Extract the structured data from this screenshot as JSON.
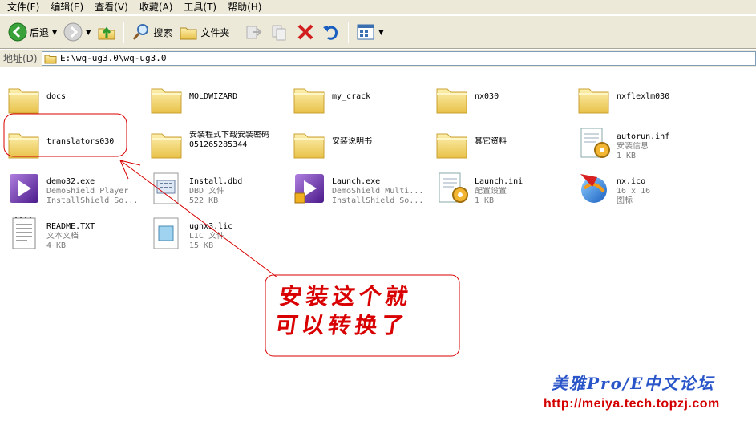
{
  "menu": [
    "文件(F)",
    "编辑(E)",
    "查看(V)",
    "收藏(A)",
    "工具(T)",
    "帮助(H)"
  ],
  "toolbar": {
    "back_label": "后退",
    "search_label": "搜索",
    "folders_label": "文件夹"
  },
  "address": {
    "label": "地址(D)",
    "path": "E:\\wq-ug3.0\\wq-ug3.0"
  },
  "files": [
    {
      "name": "docs",
      "type": "folder"
    },
    {
      "name": "MOLDWIZARD",
      "type": "folder"
    },
    {
      "name": "my_crack",
      "type": "folder"
    },
    {
      "name": "nx030",
      "type": "folder"
    },
    {
      "name": "nxflexlm030",
      "type": "folder"
    },
    {
      "name": "translators030",
      "type": "folder"
    },
    {
      "name": "安装程式下载安装密码051265285344",
      "type": "folder"
    },
    {
      "name": "安装说明书",
      "type": "folder"
    },
    {
      "name": "其它资料",
      "type": "folder"
    },
    {
      "name": "autorun.inf",
      "type": "inf",
      "line2": "安装信息",
      "line3": "1 KB"
    },
    {
      "name": "demo32.exe",
      "type": "exe",
      "line2": "DemoShield Player",
      "line3": "InstallShield So..."
    },
    {
      "name": "Install.dbd",
      "type": "dbd",
      "line2": "DBD 文件",
      "line3": "522 KB"
    },
    {
      "name": "Launch.exe",
      "type": "exe2",
      "line2": "DemoShield Multi...",
      "line3": "InstallShield So..."
    },
    {
      "name": "Launch.ini",
      "type": "ini",
      "line2": "配置设置",
      "line3": "1 KB"
    },
    {
      "name": "nx.ico",
      "type": "ico",
      "line2": "16 x 16",
      "line3": "图标"
    },
    {
      "name": "README.TXT",
      "type": "txt",
      "line2": "文本文档",
      "line3": "4 KB"
    },
    {
      "name": "ugnx3.lic",
      "type": "lic",
      "line2": "LIC 文件",
      "line3": "15 KB"
    }
  ],
  "annotation": {
    "line1": "安装这个就",
    "line2": "可以转换了",
    "color": "#d80000"
  },
  "watermark": {
    "forum": "美雅Pro/E中文论坛",
    "url": "http://meiya.tech.topzj.com"
  },
  "colors": {
    "chrome": "#ece9d8",
    "folder": "#f6d56b",
    "annotation_red": "#d80000",
    "watermark_blue": "#2a55c8"
  }
}
